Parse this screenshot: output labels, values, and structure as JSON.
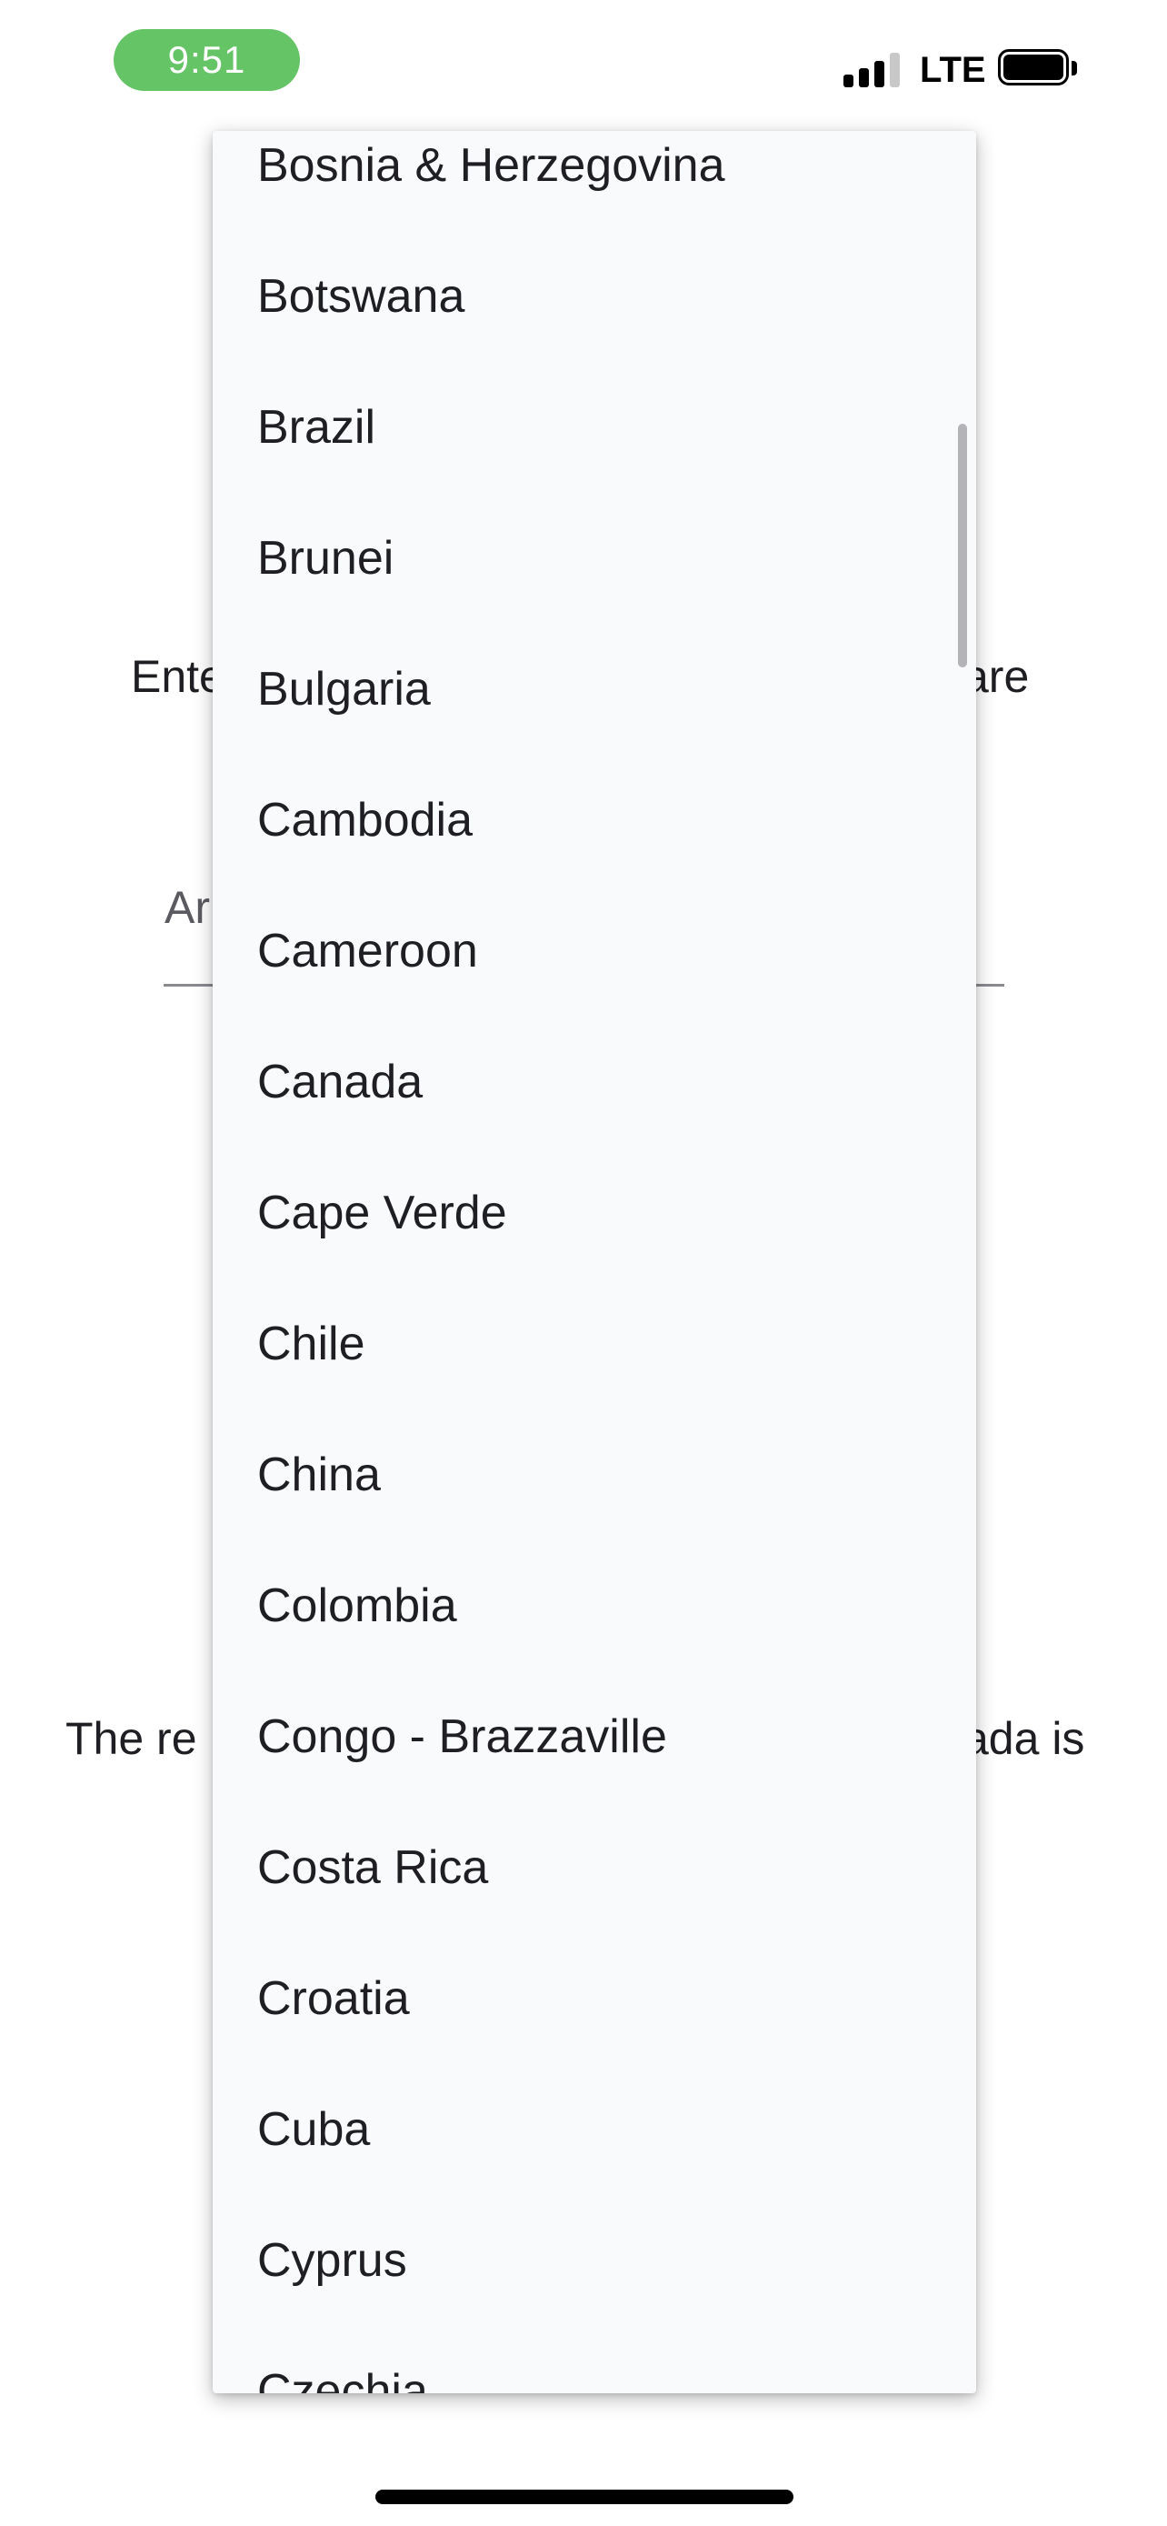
{
  "status_bar": {
    "time": "9:51",
    "network": "LTE",
    "icons": [
      "signal-icon",
      "battery-icon"
    ],
    "colors": {
      "time_pill": "#65c466"
    }
  },
  "background": {
    "enter_prefix": "Ente",
    "enter_suffix": "are",
    "amount_hint": "Ar",
    "result_prefix": "The re",
    "result_suffix": "ada is"
  },
  "dropdown": {
    "items": [
      "Bosnia & Herzegovina",
      "Botswana",
      "Brazil",
      "Brunei",
      "Bulgaria",
      "Cambodia",
      "Cameroon",
      "Canada",
      "Cape Verde",
      "Chile",
      "China",
      "Colombia",
      "Congo - Brazzaville",
      "Costa Rica",
      "Croatia",
      "Cuba",
      "Cyprus",
      "Czechia"
    ]
  }
}
